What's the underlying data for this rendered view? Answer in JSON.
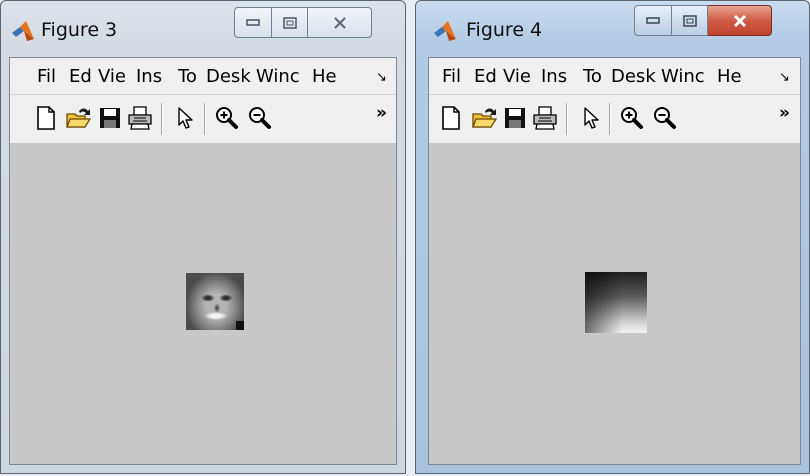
{
  "windows": [
    {
      "title": "Figure 3",
      "state": "inactive",
      "menu": [
        "Fil",
        "Ed",
        "Vie",
        "Ins",
        "To",
        "Desk",
        "Winc",
        "He"
      ],
      "menu_more": "↘",
      "toolbar": [
        "new-figure-icon",
        "open-folder-icon",
        "save-icon",
        "print-icon",
        "pointer-icon",
        "zoom-in-icon",
        "zoom-out-icon"
      ],
      "toolbar_more": "»",
      "image": "grayscale-face-thumbnail"
    },
    {
      "title": "Figure 4",
      "state": "active",
      "menu": [
        "Fil",
        "Ed",
        "Vie",
        "Ins",
        "To",
        "Desk",
        "Winc",
        "He"
      ],
      "menu_more": "↘",
      "toolbar": [
        "new-figure-icon",
        "open-folder-icon",
        "save-icon",
        "print-icon",
        "pointer-icon",
        "zoom-in-icon",
        "zoom-out-icon"
      ],
      "toolbar_more": "»",
      "image": "grayscale-gradient-square"
    }
  ],
  "colors": {
    "canvas_background": "#c8c8c8",
    "close_button_active": "#c8452e"
  }
}
